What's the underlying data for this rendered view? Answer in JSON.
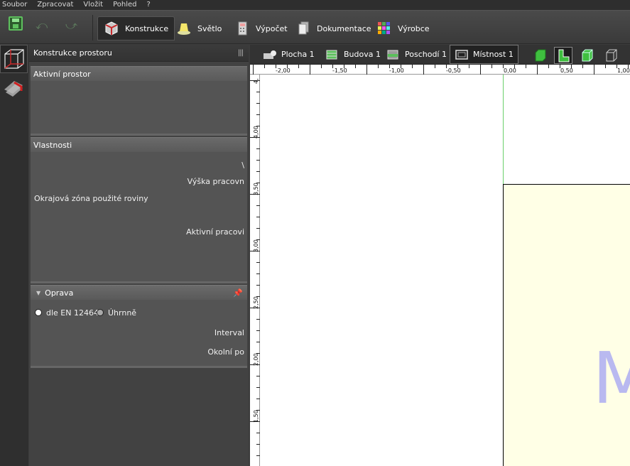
{
  "menu": [
    "Soubor",
    "Zpracovat",
    "Vložit",
    "Pohled",
    "?"
  ],
  "toolbar": {
    "tabs": [
      {
        "label": "Konstrukce",
        "active": true
      },
      {
        "label": "Světlo"
      },
      {
        "label": "Výpočet"
      },
      {
        "label": "Dokumentace"
      },
      {
        "label": "Výrobce"
      }
    ]
  },
  "panel": {
    "title": "Konstrukce prostoru",
    "sections": {
      "active_space": {
        "title": "Aktivní prostor"
      },
      "properties": {
        "title": "Vlastnosti",
        "rows": [
          "\\",
          "Výška pracovn",
          "Okrajová zóna použité roviny",
          "Aktivní pracovi"
        ]
      },
      "correction": {
        "title": "Oprava",
        "option_en": "dle EN 12464",
        "option_total": "Úhrnně",
        "interval_label": "Interval",
        "ambient_label": "Okolní po"
      }
    }
  },
  "view_tabs": [
    "Plocha 1",
    "Budova 1",
    "Poschodí 1",
    "Místnost 1"
  ],
  "ruler": {
    "h_labels": [
      "-2,00",
      "-1,50",
      "-1,00",
      "-0,50",
      "0,00",
      "0,50",
      "1,00"
    ],
    "v_labels": [
      "4,",
      "4,00",
      "3,50",
      "3,00",
      "2,50",
      "2,00",
      "1,50"
    ]
  },
  "canvas": {
    "room_label": "M"
  },
  "colors": {
    "room_fill": "#ffffe6",
    "axis_line": "#6bd06b",
    "room_label": "#b9b9f0",
    "accent_green": "#3fbf3f"
  }
}
